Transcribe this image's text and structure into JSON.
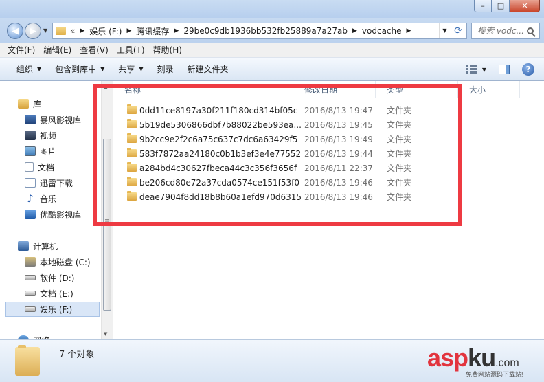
{
  "window": {
    "minimize": "–",
    "maximize": "□",
    "close": "✕"
  },
  "address": {
    "prefix": "«",
    "crumbs": [
      "娱乐 (F:)",
      "腾讯缓存",
      "29be0c9db1936bb532fb25889a7a27ab",
      "vodcache"
    ],
    "search_placeholder": "搜索 vodc..."
  },
  "menu": [
    "文件(F)",
    "编辑(E)",
    "查看(V)",
    "工具(T)",
    "帮助(H)"
  ],
  "toolbar": {
    "organize": "组织",
    "include_library": "包含到库中",
    "share": "共享",
    "burn": "刻录",
    "new_folder": "新建文件夹"
  },
  "nav": {
    "libraries": "库",
    "baofeng": "暴风影视库",
    "videos": "视频",
    "pictures": "图片",
    "documents": "文档",
    "xunlei": "迅雷下载",
    "music": "音乐",
    "youku": "优酷影视库",
    "computer": "计算机",
    "drive_c": "本地磁盘 (C:)",
    "drive_d": "软件 (D:)",
    "drive_e": "文档 (E:)",
    "drive_f": "娱乐 (F:)",
    "network": "网络"
  },
  "columns": {
    "name": "名称",
    "modified": "修改日期",
    "type": "类型",
    "size": "大小"
  },
  "files": [
    {
      "name": "0dd11ce8197a30f211f180cd314bf05c",
      "date": "2016/8/13 19:47",
      "type": "文件夹"
    },
    {
      "name": "5b19de5306866dbf7b88022be593ea...",
      "date": "2016/8/13 19:45",
      "type": "文件夹"
    },
    {
      "name": "9b2cc9e2f2c6a75c637c7dc6a63429f5",
      "date": "2016/8/13 19:49",
      "type": "文件夹"
    },
    {
      "name": "583f7872aa24180c0b1b3ef3e4e77552",
      "date": "2016/8/13 19:44",
      "type": "文件夹"
    },
    {
      "name": "a284bd4c30627fbeca44c3c356f3656f",
      "date": "2016/8/11 22:37",
      "type": "文件夹"
    },
    {
      "name": "be206cd80e72a37cda0574ce151f53f0",
      "date": "2016/8/13 19:46",
      "type": "文件夹"
    },
    {
      "name": "deae7904f8dd18b8b60a1efd970d6315",
      "date": "2016/8/13 19:46",
      "type": "文件夹"
    }
  ],
  "status": {
    "count": "7 个对象"
  },
  "watermark": {
    "asp": "asp",
    "ku": "ku",
    "com": ".com",
    "sub": "免费网站源码下载站!"
  },
  "colors": {
    "highlight_box": "#ee3a42",
    "selected_nav": "#d9e6f7"
  }
}
